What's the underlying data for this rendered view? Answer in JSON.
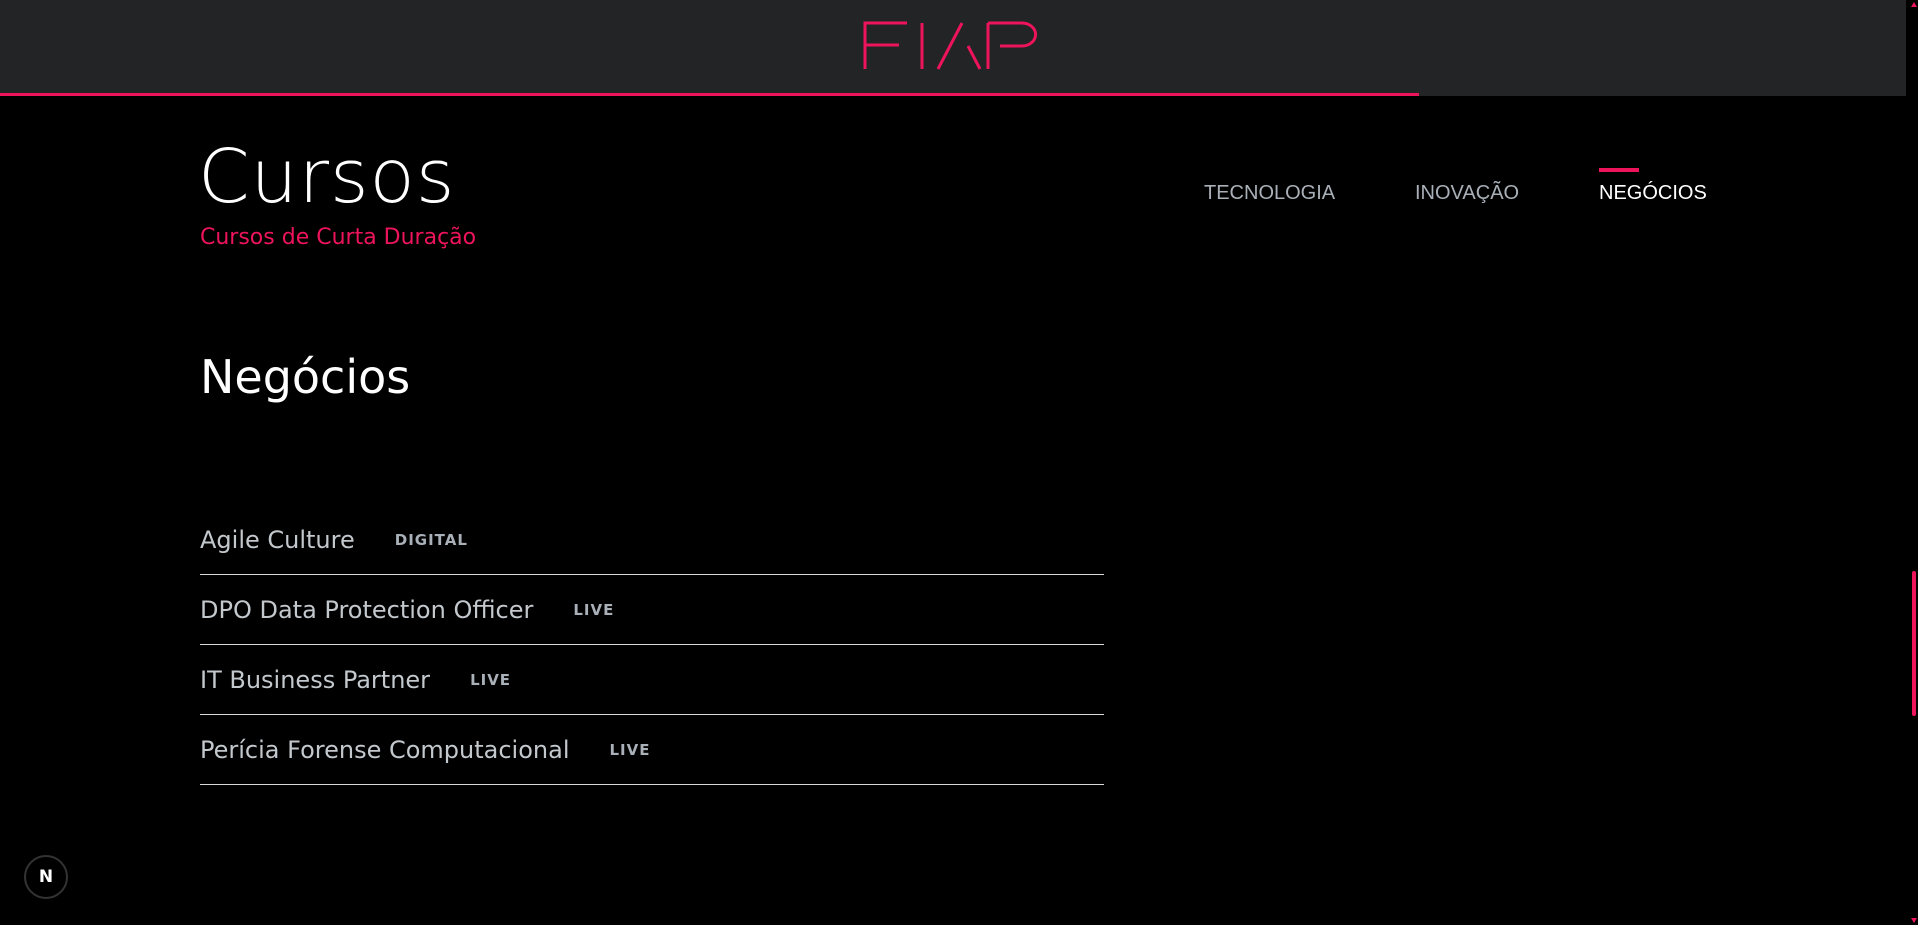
{
  "header": {
    "logo_text": "FIAP",
    "brand_color": "#ed145b",
    "scroll_progress_fraction": 0.74
  },
  "page": {
    "title": "Cursos",
    "subtitle": "Cursos de Curta Duração"
  },
  "tabs": [
    {
      "label": "TECNOLOGIA",
      "active": false
    },
    {
      "label": "INOVAÇÃO",
      "active": false
    },
    {
      "label": "NEGÓCIOS",
      "active": true
    }
  ],
  "section": {
    "title": "Negócios",
    "courses": [
      {
        "name": "Agile Culture",
        "badge": "DIGITAL"
      },
      {
        "name": "DPO Data Protection Officer",
        "badge": "LIVE"
      },
      {
        "name": "IT Business Partner",
        "badge": "LIVE"
      },
      {
        "name": "Perícia Forense Computacional",
        "badge": "LIVE"
      }
    ]
  },
  "dev_badge": {
    "letter": "N"
  }
}
